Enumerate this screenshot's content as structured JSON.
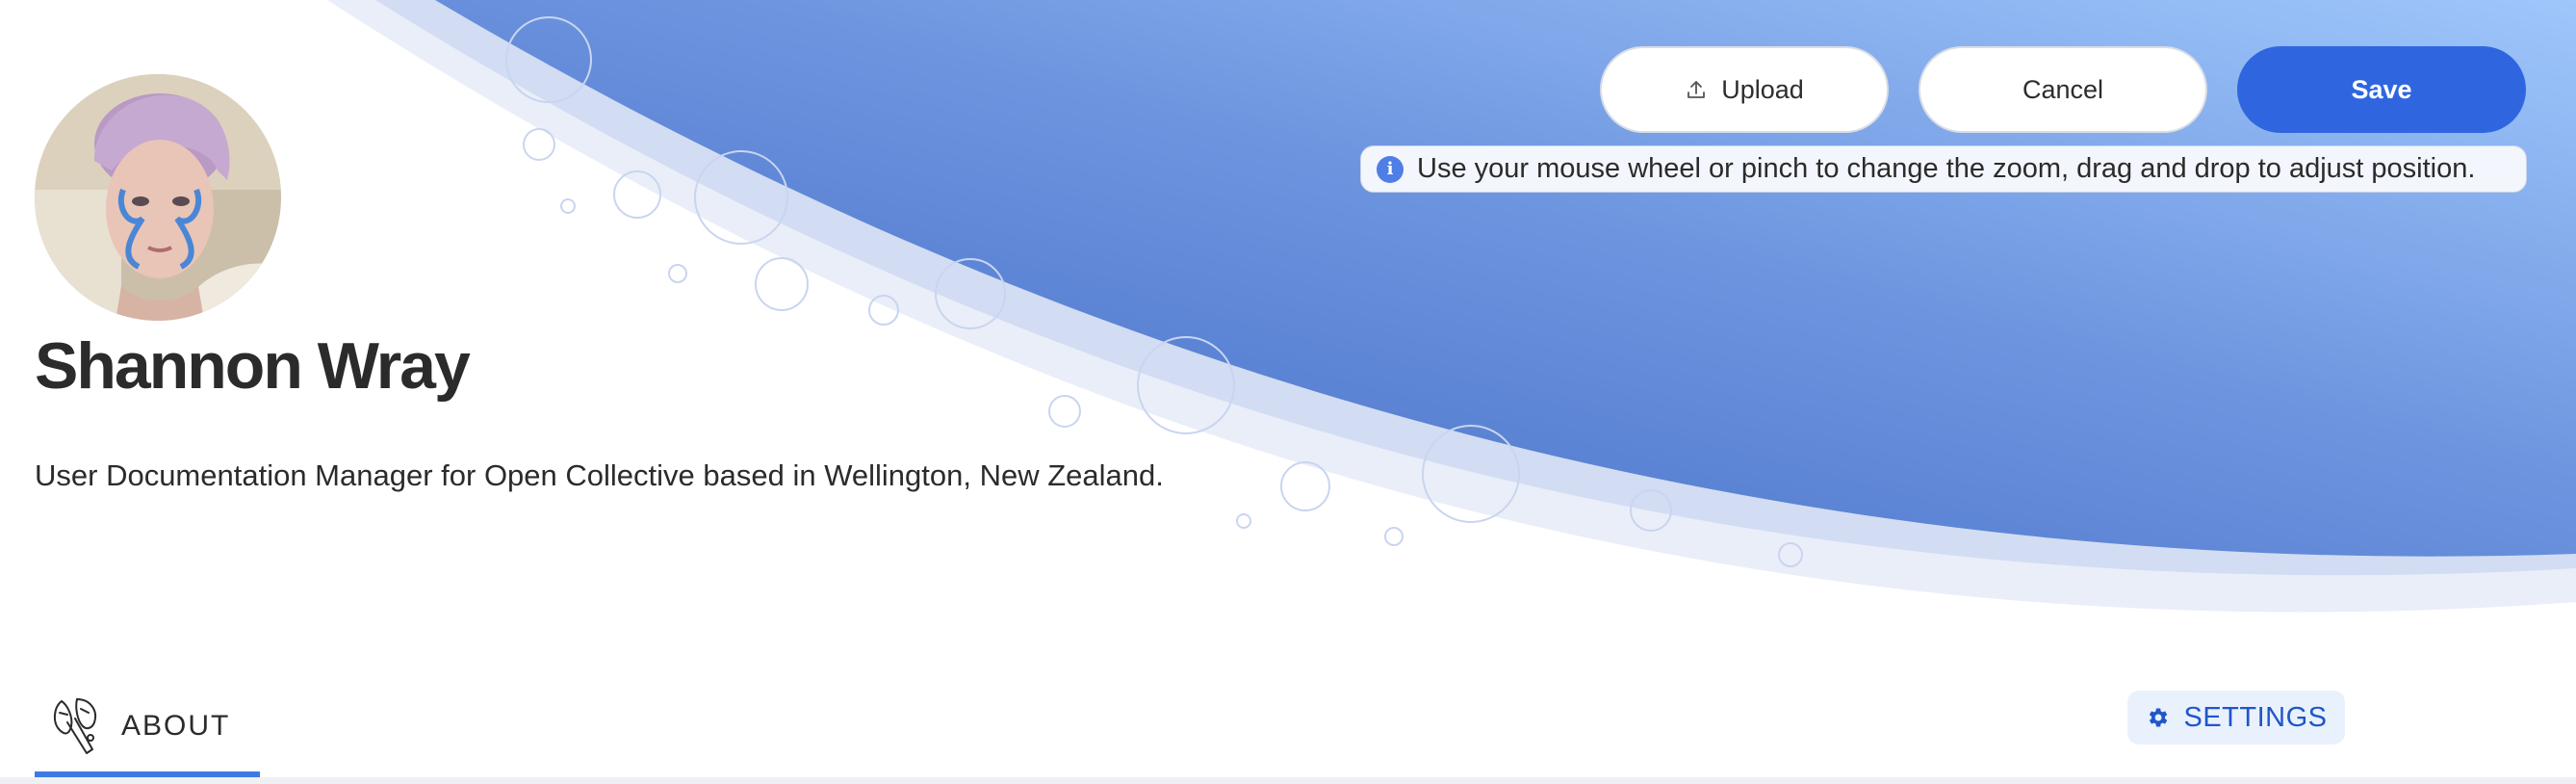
{
  "profile": {
    "name": "Shannon Wray",
    "bio": "User Documentation Manager for Open Collective based in Wellington, New Zealand."
  },
  "cover_editor": {
    "upload_label": "Upload",
    "cancel_label": "Cancel",
    "save_label": "Save",
    "hint": "Use your mouse wheel or pinch to change the zoom, drag and drop to adjust position."
  },
  "tabs": {
    "about_label": "ABOUT"
  },
  "settings": {
    "label": "SETTINGS"
  },
  "icons": {
    "upload": "upload-icon",
    "info": "info-icon",
    "about": "about-illustration-icon",
    "settings": "gear-icon"
  },
  "colors": {
    "accent": "#2f66e0",
    "cover_gradient_dark": "#4a73c9",
    "cover_gradient_light": "#95bef7",
    "tab_underline": "#3f7ae3",
    "settings_bg": "#e9f1fd",
    "settings_text": "#1f56c9"
  }
}
